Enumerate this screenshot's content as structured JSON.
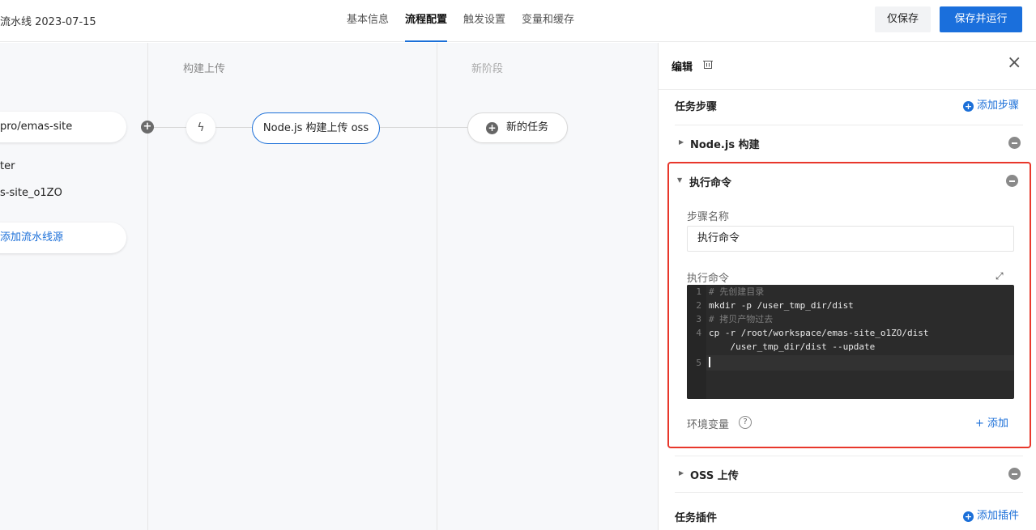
{
  "header": {
    "title": "流水线 2023-07-15",
    "tabs": [
      {
        "label": "基本信息",
        "active": false
      },
      {
        "label": "流程配置",
        "active": true
      },
      {
        "label": "触发设置",
        "active": false
      },
      {
        "label": "变量和缓存",
        "active": false
      }
    ],
    "save_only_label": "仅保存",
    "save_run_label": "保存并运行"
  },
  "canvas": {
    "stages": [
      {
        "label": "构建上传"
      },
      {
        "label": "新阶段"
      }
    ],
    "source": {
      "repo": "pro/emas-site",
      "branch": "ter",
      "artifact": "s-site_o1ZO",
      "add_source_label": "添加流水线源"
    },
    "job_label": "Node.js 构建上传 oss",
    "new_task_label": "新的任务"
  },
  "panel": {
    "title": "编辑",
    "task_steps_label": "任务步骤",
    "add_step_label": "添加步骤",
    "steps": [
      {
        "name": "Node.js 构建",
        "expanded": false
      },
      {
        "name": "执行命令",
        "expanded": true
      },
      {
        "name": "OSS 上传",
        "expanded": false
      }
    ],
    "step_name_label": "步骤名称",
    "step_name_value": "执行命令",
    "command_label": "执行命令",
    "code_lines": [
      {
        "n": "1",
        "text": "# 先创建目录"
      },
      {
        "n": "2",
        "text": "mkdir -p /user_tmp_dir/dist"
      },
      {
        "n": "3",
        "text": "# 拷贝产物过去"
      },
      {
        "n": "4",
        "text": "cp -r /root/workspace/emas-site_o1ZO/dist"
      },
      {
        "n": "",
        "text": "    /user_tmp_dir/dist --update"
      },
      {
        "n": "5",
        "text": ""
      }
    ],
    "env_label": "环境变量",
    "env_add_label": "+ 添加",
    "task_plugins_label": "任务插件",
    "add_plugin_label": "添加插件"
  },
  "colors": {
    "accent": "#1b6fd8",
    "highlight_border": "#e8372b",
    "code_bg": "#2b2b2b"
  }
}
